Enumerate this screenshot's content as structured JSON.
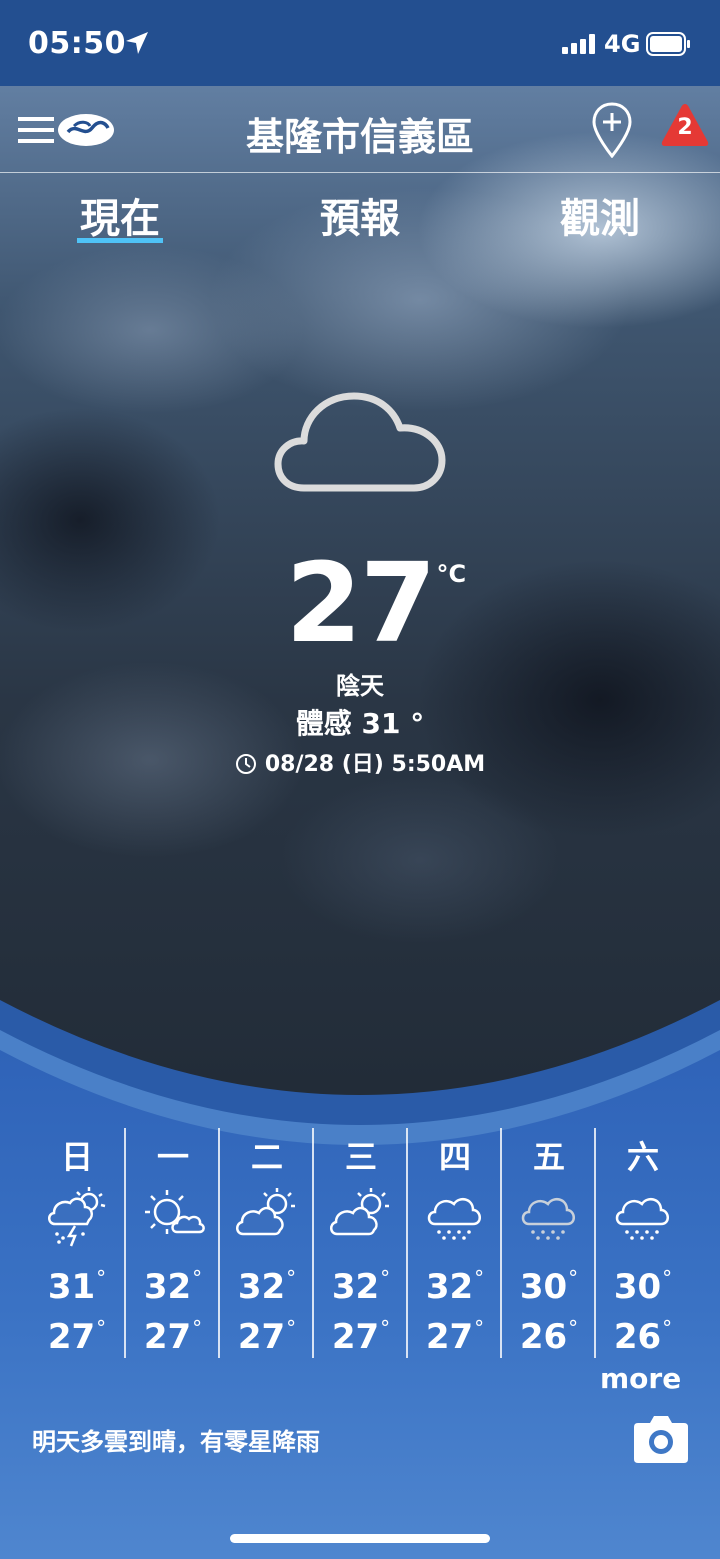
{
  "status": {
    "time": "05:50",
    "network": "4G"
  },
  "header": {
    "city": "基隆市信義區",
    "alert_count": "2"
  },
  "tabs": [
    {
      "label": "現在"
    },
    {
      "label": "預報"
    },
    {
      "label": "觀測"
    }
  ],
  "current": {
    "temperature": "27",
    "unit": "°C",
    "condition": "陰天",
    "feels_like": "體感 31 °",
    "updated": "08/28 (日) 5:50AM",
    "icon": "cloud-icon"
  },
  "forecast": [
    {
      "day": "日",
      "high": "31",
      "low": "27",
      "icon": "thunder-shower-sun-icon"
    },
    {
      "day": "一",
      "high": "32",
      "low": "27",
      "icon": "sun-cloud-icon"
    },
    {
      "day": "二",
      "high": "32",
      "low": "27",
      "icon": "cloud-sun-icon"
    },
    {
      "day": "三",
      "high": "32",
      "low": "27",
      "icon": "cloud-sun-icon"
    },
    {
      "day": "四",
      "high": "32",
      "low": "27",
      "icon": "rain-icon"
    },
    {
      "day": "五",
      "high": "30",
      "low": "26",
      "icon": "rain-icon"
    },
    {
      "day": "六",
      "high": "30",
      "low": "26",
      "icon": "rain-icon"
    }
  ],
  "more_label": "more",
  "summary": "明天多雲到晴，有零星降雨",
  "colors": {
    "accent": "#4fc3f7",
    "status_bar": "#234f90",
    "alert": "#e53935",
    "panel": "#2f63b8"
  }
}
